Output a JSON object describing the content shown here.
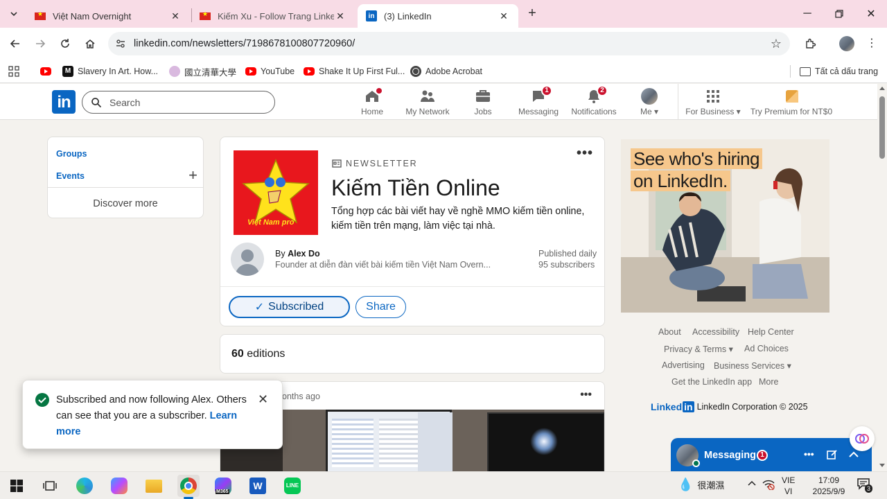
{
  "browser": {
    "tabs": [
      {
        "title": "Việt Nam Overnight",
        "active": false
      },
      {
        "title": "Kiếm Xu - Follow Trang LinkedIn",
        "active": false
      },
      {
        "title": "(3) LinkedIn",
        "active": true
      }
    ],
    "url": "linkedin.com/newsletters/7198678100807720960/",
    "bookmarks": [
      "Slavery In Art. How...",
      "國立清華大學",
      "YouTube",
      "Shake It Up First Ful...",
      "Adobe Acrobat"
    ],
    "all_bookmarks": "Tất cả dấu trang"
  },
  "linkedin": {
    "search_placeholder": "Search",
    "nav": {
      "home": "Home",
      "network": "My Network",
      "jobs": "Jobs",
      "messaging": "Messaging",
      "messaging_badge": "1",
      "notifications": "Notifications",
      "notifications_badge": "2",
      "me": "Me",
      "for_business": "For Business",
      "premium": "Try Premium for NT$0"
    },
    "sidebar": {
      "groups": "Groups",
      "events": "Events",
      "discover": "Discover more"
    },
    "newsletter": {
      "logo_text": "Việt Nam pro",
      "label": "NEWSLETTER",
      "title": "Kiếm Tiền Online",
      "description": "Tổng hợp các bài viết hay về nghề MMO kiếm tiền online, kiếm tiền trên mạng, làm việc tại nhà.",
      "by": "By",
      "author": "Alex Do",
      "author_headline": "Founder at diễn đàn viết bài kiếm tiền Việt Nam Overn...",
      "frequency": "Published daily",
      "subscribers": "95 subscribers",
      "subscribed_btn": "Subscribed",
      "share_btn": "Share"
    },
    "editions": {
      "count": "60",
      "label": "editions"
    },
    "post": {
      "time": "onths ago"
    },
    "toast": {
      "text": "Subscribed and now following Alex. Others can see that you are a subscriber.",
      "link": "Learn more"
    },
    "ad": {
      "line1": "See who's hiring",
      "line2": "on LinkedIn."
    },
    "footer": {
      "about": "About",
      "accessibility": "Accessibility",
      "help": "Help Center",
      "privacy": "Privacy & Terms",
      "adchoices": "Ad Choices",
      "advertising": "Advertising",
      "business": "Business Services",
      "app": "Get the LinkedIn app",
      "more": "More",
      "brand": "Linked",
      "copyright": "LinkedIn Corporation © 2025"
    },
    "messaging_bar": {
      "label": "Messaging",
      "badge": "1"
    }
  },
  "taskbar": {
    "weather": "很潮濕",
    "lang1": "VIE",
    "lang2": "VI",
    "time": "17:09",
    "date": "2025/9/9",
    "notif_count": "3",
    "m365": "M365"
  }
}
